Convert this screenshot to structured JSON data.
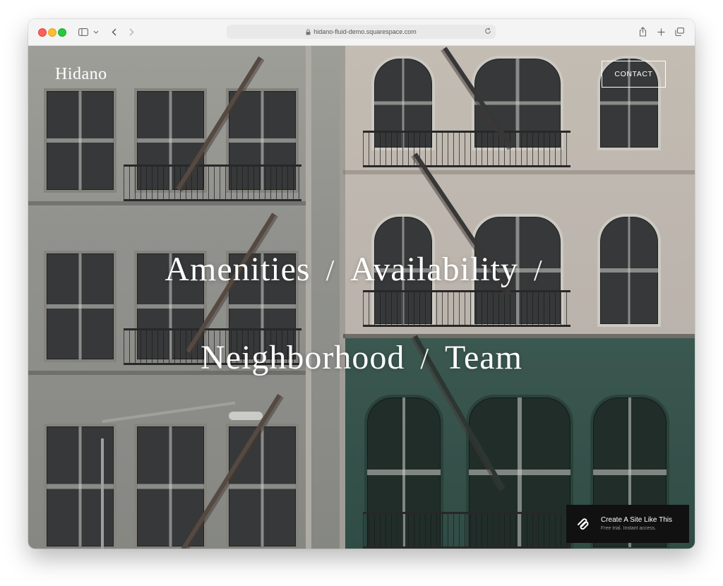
{
  "browser": {
    "url": "hidano-fluid-demo.squarespace.com"
  },
  "site": {
    "logo": "Hidano",
    "contact_label": "CONTACT",
    "nav_line1": [
      {
        "label": "Amenities"
      },
      {
        "label": "Availability"
      }
    ],
    "nav_line2": [
      {
        "label": "Neighborhood"
      },
      {
        "label": "Team"
      }
    ],
    "separator": "/"
  },
  "badge": {
    "title": "Create A Site Like This",
    "subtitle": "Free trial. Instant access."
  },
  "colors": {
    "traffic_red": "#fe5f57",
    "traffic_yellow": "#febc2e",
    "traffic_green": "#28c840",
    "badge_bg": "#111111",
    "hero_text": "#ffffff"
  },
  "icons": [
    "sidebar-icon",
    "chevron-down-icon",
    "back-icon",
    "forward-icon",
    "lock-icon",
    "reload-icon",
    "share-icon",
    "new-tab-icon",
    "tabs-overview-icon",
    "squarespace-logo-icon"
  ]
}
